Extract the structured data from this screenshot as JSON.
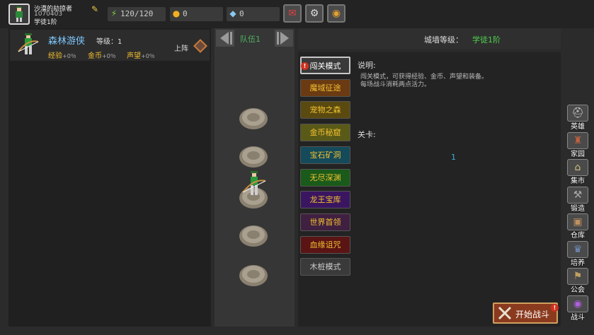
{
  "player": {
    "name": "沙漠的劫掠者",
    "id": "1070403",
    "rank": "学徒1阶",
    "stamina": "120/120",
    "gold": "0",
    "diamond": "0"
  },
  "hero": {
    "name": "森林游侠",
    "level_label": "等级：",
    "level": "1",
    "exp_label": "经验",
    "exp_val": "+0％",
    "gold_label": "金币",
    "gold_val": "+0％",
    "fame_label": "声望",
    "fame_val": "+0％",
    "deploy_label": "上阵"
  },
  "team": {
    "label": "队伍1"
  },
  "wall": {
    "label": "城墙等级：",
    "value": "学徒1阶"
  },
  "modes": [
    {
      "label": "闯关模式",
      "color": "#3a3a3a"
    },
    {
      "label": "魔域征途",
      "color": "#6a3a12"
    },
    {
      "label": "宠物之森",
      "color": "#5a4a10"
    },
    {
      "label": "金币秘窟",
      "color": "#5a5a18"
    },
    {
      "label": "宝石矿洞",
      "color": "#144a5a"
    },
    {
      "label": "无尽深渊",
      "color": "#1a5a1a"
    },
    {
      "label": "龙王宝库",
      "color": "#3a1660"
    },
    {
      "label": "世界首领",
      "color": "#402040"
    },
    {
      "label": "血缘诅咒",
      "color": "#5a1414"
    },
    {
      "label": "木桩模式",
      "color": "#3a3a3a"
    }
  ],
  "description": {
    "title": "说明:",
    "line1": "闯关模式，可获得经验、金币、声望和装备。",
    "line2": "每场战斗消耗两点活力。"
  },
  "stage": {
    "title": "关卡:",
    "number": "1"
  },
  "start_button": {
    "label": "开始战斗"
  },
  "nav": [
    {
      "label": "英雄",
      "icon": "helmet-icon"
    },
    {
      "label": "家园",
      "icon": "castle-icon"
    },
    {
      "label": "集市",
      "icon": "market-icon"
    },
    {
      "label": "锻造",
      "icon": "anvil-icon"
    },
    {
      "label": "仓库",
      "icon": "crate-icon"
    },
    {
      "label": "培养",
      "icon": "trophy-icon"
    },
    {
      "label": "公会",
      "icon": "guild-icon"
    },
    {
      "label": "战斗",
      "icon": "battle-orb-icon"
    }
  ],
  "colors": {
    "accent_green": "#4fd04f",
    "hero_name": "#7ec8ff",
    "gold_text": "#f2c030",
    "stage_blue": "#3cb0e0"
  }
}
